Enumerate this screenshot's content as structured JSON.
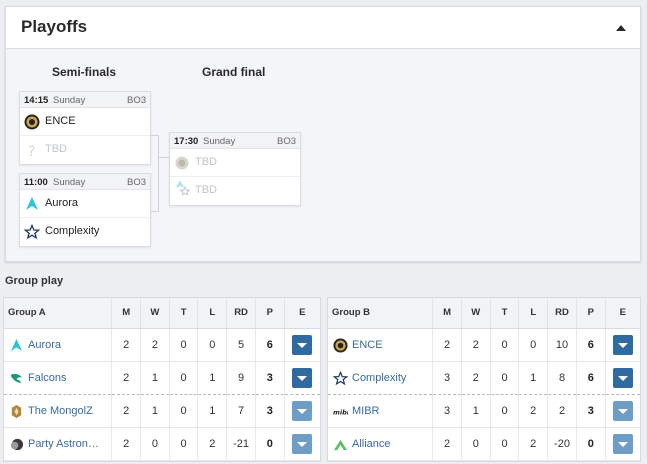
{
  "playoffs": {
    "title": "Playoffs",
    "rounds": [
      "Semi-finals",
      "Grand final"
    ],
    "matches": [
      {
        "time": "14:15",
        "day": "Sunday",
        "format": "BO3",
        "teams": [
          {
            "name": "ENCE",
            "logo": "ence-logo"
          },
          {
            "name": "TBD",
            "logo": "tbd-logo"
          }
        ]
      },
      {
        "time": "11:00",
        "day": "Sunday",
        "format": "BO3",
        "teams": [
          {
            "name": "Aurora",
            "logo": "aurora-logo"
          },
          {
            "name": "Complexity",
            "logo": "complexity-logo"
          }
        ]
      },
      {
        "time": "17:30",
        "day": "Sunday",
        "format": "BO3",
        "teams": [
          {
            "name": "TBD",
            "logo": "tbd-logo"
          },
          {
            "name": "TBD",
            "logo": "tbd-logo"
          }
        ]
      }
    ]
  },
  "group_play": {
    "title": "Group play",
    "columns": [
      "M",
      "W",
      "T",
      "L",
      "RD",
      "P",
      "E"
    ],
    "groups": [
      {
        "name": "Group A",
        "rows": [
          {
            "team": "Aurora",
            "logo": "aurora-logo",
            "M": "2",
            "W": "2",
            "T": "0",
            "L": "0",
            "RD": "5",
            "P": "6"
          },
          {
            "team": "Falcons",
            "logo": "falcons-logo",
            "M": "2",
            "W": "1",
            "T": "0",
            "L": "1",
            "RD": "9",
            "P": "3"
          },
          {
            "team": "The MongolZ",
            "logo": "mongolz-logo",
            "M": "2",
            "W": "1",
            "T": "0",
            "L": "1",
            "RD": "7",
            "P": "3"
          },
          {
            "team": "Party Astron…",
            "logo": "party-astronauts-logo",
            "M": "2",
            "W": "0",
            "T": "0",
            "L": "2",
            "RD": "-21",
            "P": "0"
          }
        ]
      },
      {
        "name": "Group B",
        "rows": [
          {
            "team": "ENCE",
            "logo": "ence-logo",
            "M": "2",
            "W": "2",
            "T": "0",
            "L": "0",
            "RD": "10",
            "P": "6"
          },
          {
            "team": "Complexity",
            "logo": "complexity-logo",
            "M": "3",
            "W": "2",
            "T": "0",
            "L": "1",
            "RD": "8",
            "P": "6"
          },
          {
            "team": "MIBR",
            "logo": "mibr-logo",
            "M": "3",
            "W": "1",
            "T": "0",
            "L": "2",
            "RD": "2",
            "P": "3"
          },
          {
            "team": "Alliance",
            "logo": "alliance-logo",
            "M": "2",
            "W": "0",
            "T": "0",
            "L": "2",
            "RD": "-20",
            "P": "0"
          }
        ]
      }
    ]
  },
  "colors": {
    "link": "#3a6a9e",
    "button_dark": "#2f6aa0",
    "button_light": "#6e9dc7",
    "aurora": "#2ec3d6",
    "falcons": "#1d9b78",
    "alliance": "#5cc06a"
  }
}
